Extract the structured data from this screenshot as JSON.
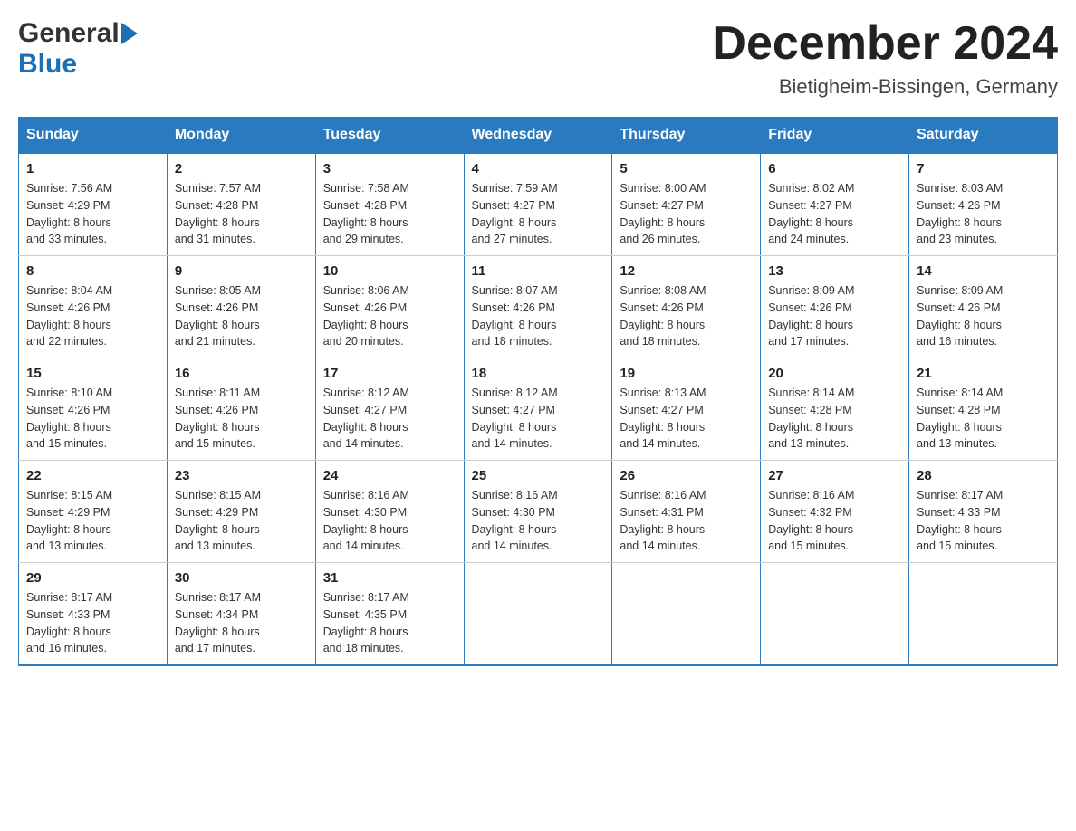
{
  "logo": {
    "general": "General",
    "blue": "Blue",
    "triangle": "▶"
  },
  "title": "December 2024",
  "subtitle": "Bietigheim-Bissingen, Germany",
  "headers": [
    "Sunday",
    "Monday",
    "Tuesday",
    "Wednesday",
    "Thursday",
    "Friday",
    "Saturday"
  ],
  "weeks": [
    [
      {
        "day": "1",
        "sunrise": "7:56 AM",
        "sunset": "4:29 PM",
        "daylight": "8 hours and 33 minutes."
      },
      {
        "day": "2",
        "sunrise": "7:57 AM",
        "sunset": "4:28 PM",
        "daylight": "8 hours and 31 minutes."
      },
      {
        "day": "3",
        "sunrise": "7:58 AM",
        "sunset": "4:28 PM",
        "daylight": "8 hours and 29 minutes."
      },
      {
        "day": "4",
        "sunrise": "7:59 AM",
        "sunset": "4:27 PM",
        "daylight": "8 hours and 27 minutes."
      },
      {
        "day": "5",
        "sunrise": "8:00 AM",
        "sunset": "4:27 PM",
        "daylight": "8 hours and 26 minutes."
      },
      {
        "day": "6",
        "sunrise": "8:02 AM",
        "sunset": "4:27 PM",
        "daylight": "8 hours and 24 minutes."
      },
      {
        "day": "7",
        "sunrise": "8:03 AM",
        "sunset": "4:26 PM",
        "daylight": "8 hours and 23 minutes."
      }
    ],
    [
      {
        "day": "8",
        "sunrise": "8:04 AM",
        "sunset": "4:26 PM",
        "daylight": "8 hours and 22 minutes."
      },
      {
        "day": "9",
        "sunrise": "8:05 AM",
        "sunset": "4:26 PM",
        "daylight": "8 hours and 21 minutes."
      },
      {
        "day": "10",
        "sunrise": "8:06 AM",
        "sunset": "4:26 PM",
        "daylight": "8 hours and 20 minutes."
      },
      {
        "day": "11",
        "sunrise": "8:07 AM",
        "sunset": "4:26 PM",
        "daylight": "8 hours and 18 minutes."
      },
      {
        "day": "12",
        "sunrise": "8:08 AM",
        "sunset": "4:26 PM",
        "daylight": "8 hours and 18 minutes."
      },
      {
        "day": "13",
        "sunrise": "8:09 AM",
        "sunset": "4:26 PM",
        "daylight": "8 hours and 17 minutes."
      },
      {
        "day": "14",
        "sunrise": "8:09 AM",
        "sunset": "4:26 PM",
        "daylight": "8 hours and 16 minutes."
      }
    ],
    [
      {
        "day": "15",
        "sunrise": "8:10 AM",
        "sunset": "4:26 PM",
        "daylight": "8 hours and 15 minutes."
      },
      {
        "day": "16",
        "sunrise": "8:11 AM",
        "sunset": "4:26 PM",
        "daylight": "8 hours and 15 minutes."
      },
      {
        "day": "17",
        "sunrise": "8:12 AM",
        "sunset": "4:27 PM",
        "daylight": "8 hours and 14 minutes."
      },
      {
        "day": "18",
        "sunrise": "8:12 AM",
        "sunset": "4:27 PM",
        "daylight": "8 hours and 14 minutes."
      },
      {
        "day": "19",
        "sunrise": "8:13 AM",
        "sunset": "4:27 PM",
        "daylight": "8 hours and 14 minutes."
      },
      {
        "day": "20",
        "sunrise": "8:14 AM",
        "sunset": "4:28 PM",
        "daylight": "8 hours and 13 minutes."
      },
      {
        "day": "21",
        "sunrise": "8:14 AM",
        "sunset": "4:28 PM",
        "daylight": "8 hours and 13 minutes."
      }
    ],
    [
      {
        "day": "22",
        "sunrise": "8:15 AM",
        "sunset": "4:29 PM",
        "daylight": "8 hours and 13 minutes."
      },
      {
        "day": "23",
        "sunrise": "8:15 AM",
        "sunset": "4:29 PM",
        "daylight": "8 hours and 13 minutes."
      },
      {
        "day": "24",
        "sunrise": "8:16 AM",
        "sunset": "4:30 PM",
        "daylight": "8 hours and 14 minutes."
      },
      {
        "day": "25",
        "sunrise": "8:16 AM",
        "sunset": "4:30 PM",
        "daylight": "8 hours and 14 minutes."
      },
      {
        "day": "26",
        "sunrise": "8:16 AM",
        "sunset": "4:31 PM",
        "daylight": "8 hours and 14 minutes."
      },
      {
        "day": "27",
        "sunrise": "8:16 AM",
        "sunset": "4:32 PM",
        "daylight": "8 hours and 15 minutes."
      },
      {
        "day": "28",
        "sunrise": "8:17 AM",
        "sunset": "4:33 PM",
        "daylight": "8 hours and 15 minutes."
      }
    ],
    [
      {
        "day": "29",
        "sunrise": "8:17 AM",
        "sunset": "4:33 PM",
        "daylight": "8 hours and 16 minutes."
      },
      {
        "day": "30",
        "sunrise": "8:17 AM",
        "sunset": "4:34 PM",
        "daylight": "8 hours and 17 minutes."
      },
      {
        "day": "31",
        "sunrise": "8:17 AM",
        "sunset": "4:35 PM",
        "daylight": "8 hours and 18 minutes."
      },
      null,
      null,
      null,
      null
    ]
  ],
  "labels": {
    "sunrise": "Sunrise:",
    "sunset": "Sunset:",
    "daylight": "Daylight:"
  }
}
